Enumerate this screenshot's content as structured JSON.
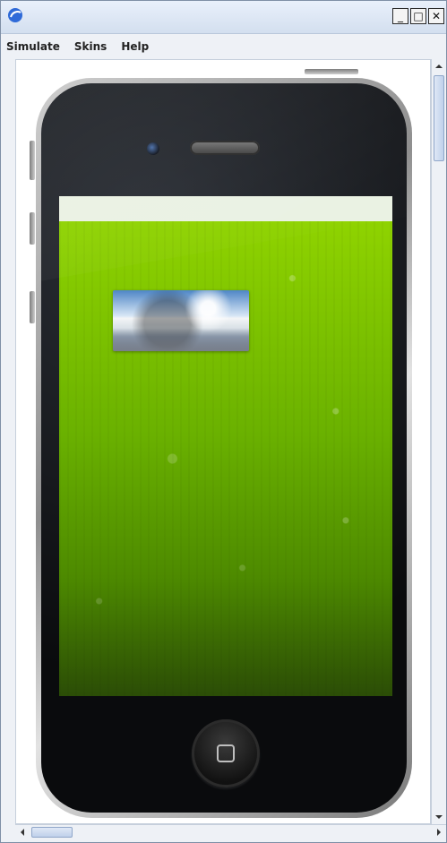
{
  "window": {
    "controls": [
      {
        "name": "minimize",
        "glyph": "_"
      },
      {
        "name": "maximize",
        "glyph": "□"
      },
      {
        "name": "close",
        "glyph": "✕"
      }
    ]
  },
  "menu": {
    "items": [
      "Simulate",
      "Skins",
      "Help"
    ]
  },
  "device": {
    "screen": {
      "status_bar_color": "#eaf2e3",
      "wallpaper_colors": [
        "#8fd300",
        "#6ab100",
        "#4d8a00",
        "#2b4d06"
      ]
    }
  },
  "colors": {
    "window_bg": "#eef1f6",
    "titlebar_top": "#e9f0fb",
    "titlebar_bottom": "#d3dfef",
    "scroll_thumb_border": "#8fa6c9"
  },
  "icons": {
    "app": "app-logo-icon",
    "scroll_up": "triangle-up-icon",
    "scroll_down": "triangle-down-icon",
    "scroll_left": "triangle-left-icon",
    "scroll_right": "triangle-right-icon"
  }
}
